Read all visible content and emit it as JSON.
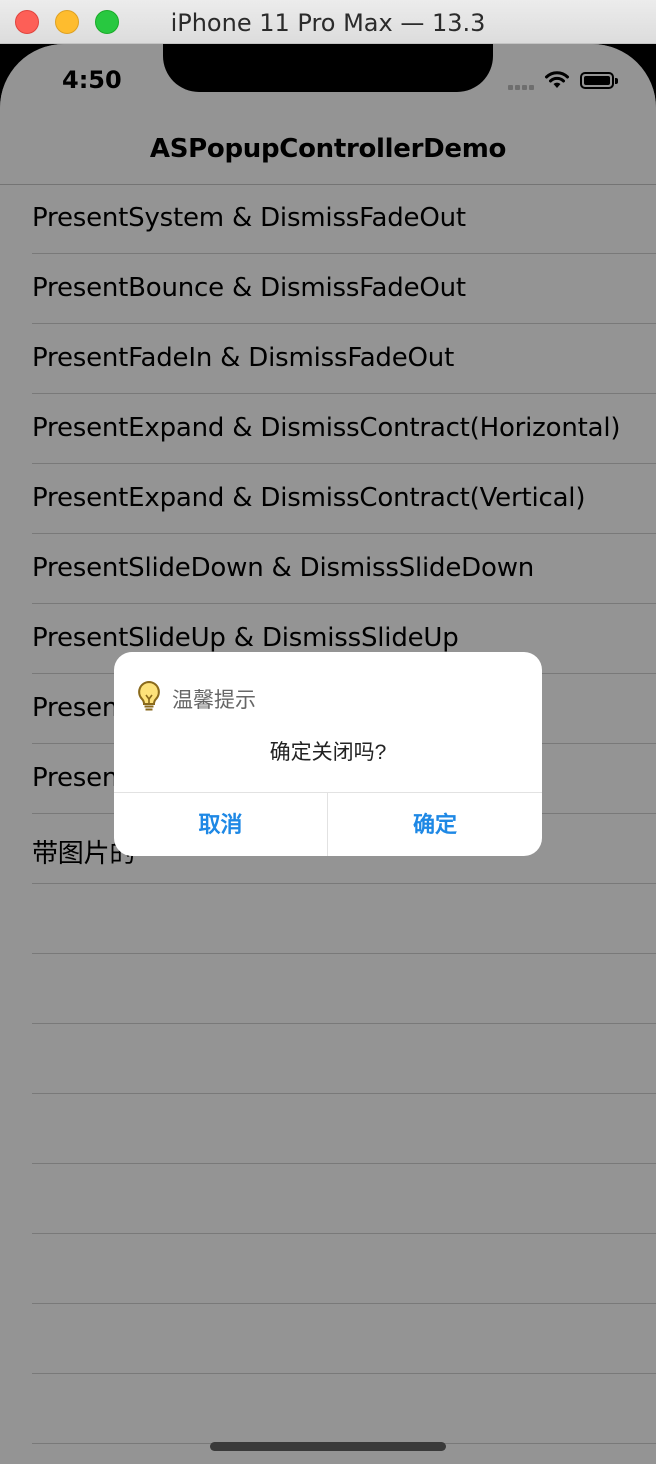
{
  "window": {
    "title": "iPhone 11 Pro Max — 13.3"
  },
  "status_bar": {
    "time": "4:50",
    "icons": [
      "cellular-signal-icon",
      "wifi-icon",
      "battery-icon"
    ]
  },
  "nav": {
    "title": "ASPopupControllerDemo"
  },
  "list": {
    "items": [
      {
        "label": "PresentSystem & DismissFadeOut"
      },
      {
        "label": "PresentBounce & DismissFadeOut"
      },
      {
        "label": "PresentFadeIn & DismissFadeOut"
      },
      {
        "label": "PresentExpand & DismissContract(Horizontal)"
      },
      {
        "label": "PresentExpand & DismissContract(Vertical)"
      },
      {
        "label": "PresentSlideDown & DismissSlideDown"
      },
      {
        "label": "PresentSlideUp & DismissSlideUp"
      },
      {
        "label": "Presen"
      },
      {
        "label": "Presen"
      },
      {
        "label": "带图片的"
      },
      {
        "label": ""
      },
      {
        "label": ""
      },
      {
        "label": ""
      },
      {
        "label": ""
      },
      {
        "label": ""
      },
      {
        "label": ""
      },
      {
        "label": ""
      },
      {
        "label": ""
      }
    ]
  },
  "popup": {
    "icon": "lightbulb-icon",
    "title": "温馨提示",
    "message": "确定关闭吗?",
    "cancel_label": "取消",
    "confirm_label": "确定",
    "accent_color": "#1e88e5"
  }
}
